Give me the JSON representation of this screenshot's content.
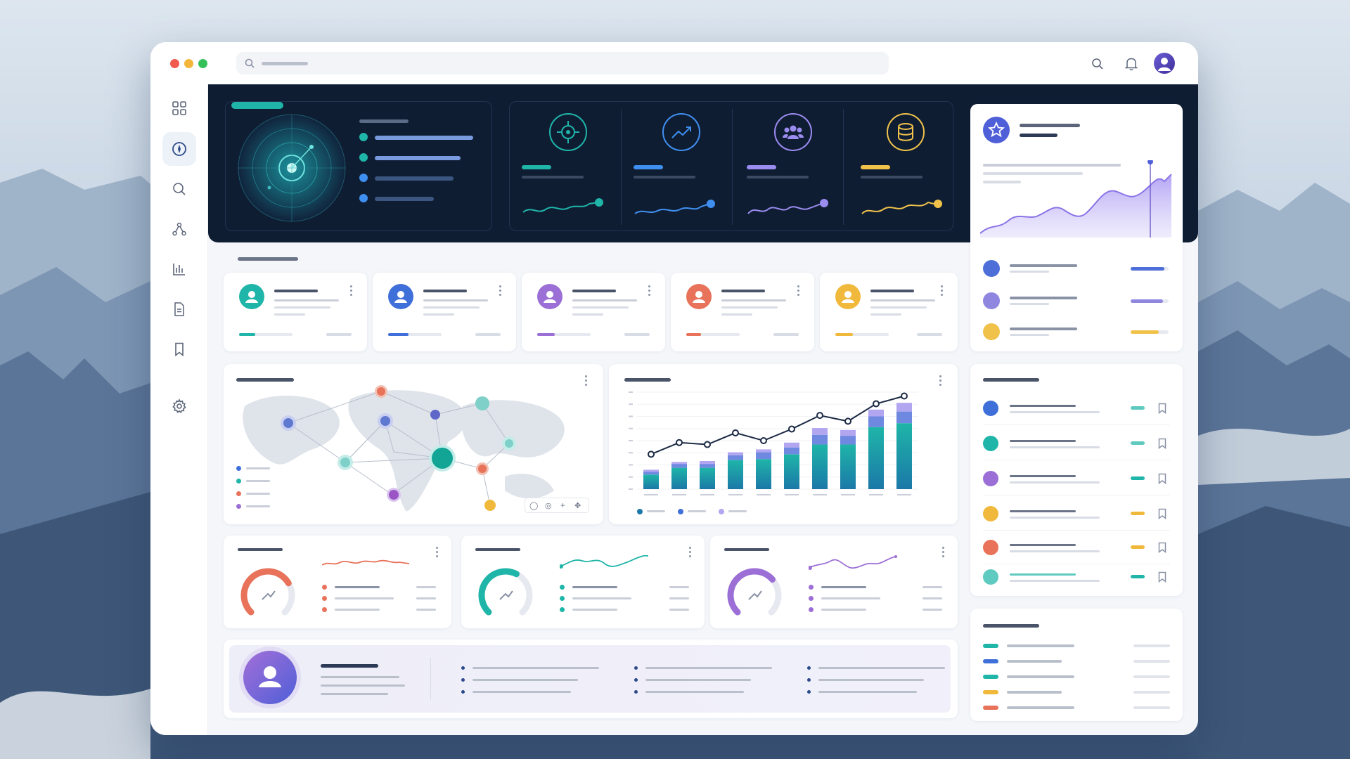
{
  "colors": {
    "teal": "#1fb5a8",
    "blue": "#3f6fd8",
    "purple": "#9b6fd6",
    "coral": "#e8725a",
    "amber": "#f0b93c",
    "navy": "#0f1d33",
    "lavender": "#b3a6f0"
  },
  "window": {
    "controls": [
      "close",
      "minimize",
      "maximize"
    ]
  },
  "toolbar": {
    "icons": [
      "search-icon",
      "bell-icon",
      "user-avatar"
    ]
  },
  "sidebar": {
    "items": [
      "grid-icon",
      "compass-icon",
      "search-icon",
      "network-icon",
      "chart-icon",
      "document-icon",
      "bookmark-icon",
      "gear-icon"
    ],
    "active_index": 1
  },
  "hero": {
    "kpi_icons": [
      "target-icon",
      "trend-up-icon",
      "users-icon",
      "database-icon"
    ],
    "kpi_colors": [
      "#1fb5a8",
      "#3f8ff0",
      "#9b8cf0",
      "#f0c24a"
    ]
  },
  "member_cards": {
    "avatar_colors": [
      "#1fb5a8",
      "#3f6fd8",
      "#9b6fd6",
      "#e8725a",
      "#f0b93c"
    ],
    "progress": [
      0.28,
      0.35,
      0.3,
      0.25,
      0.3
    ]
  },
  "bar_chart": {
    "chart_data": {
      "type": "bar",
      "categories": [
        "1",
        "2",
        "3",
        "4",
        "5",
        "6",
        "7",
        "8",
        "9",
        "10"
      ],
      "series": [
        {
          "values": [
            15,
            22,
            22,
            30,
            31,
            36,
            46,
            46,
            64,
            68
          ]
        },
        {
          "values": [
            3,
            4,
            4,
            5,
            7,
            7,
            10,
            9,
            11,
            12
          ]
        },
        {
          "values": [
            2,
            2,
            3,
            3,
            3,
            5,
            7,
            6,
            7,
            9
          ]
        }
      ],
      "line": [
        36,
        48,
        46,
        58,
        50,
        62,
        76,
        70,
        88,
        96
      ],
      "ylim": [
        0,
        100
      ]
    }
  },
  "gauges": {
    "values": [
      0.72,
      0.6,
      0.68
    ],
    "colors": [
      "#e8725a",
      "#1fb5a8",
      "#9b6fd6"
    ]
  },
  "right_list": {
    "colors": [
      "#3f6fd8",
      "#1fb5a8",
      "#9b6fd6",
      "#f0b93c",
      "#e8725a",
      "#5fcac0"
    ]
  },
  "legend_list": {
    "colors": [
      "#1fb5a8",
      "#3f6fd8",
      "#1fb5a8",
      "#f0b93c",
      "#e8725a"
    ]
  }
}
